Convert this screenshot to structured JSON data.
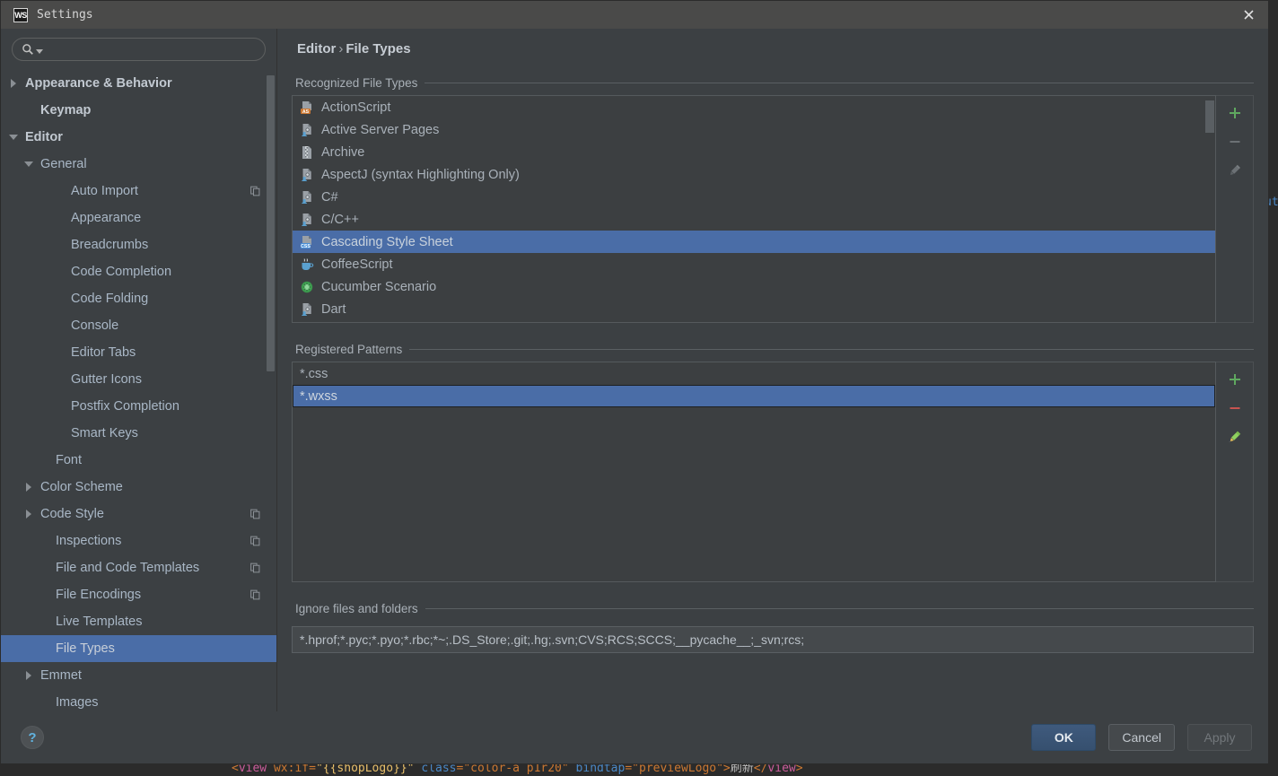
{
  "window": {
    "app_icon_label": "WS",
    "title": "Settings",
    "close_icon": "close-icon"
  },
  "sidebar": {
    "search": {
      "value": "",
      "placeholder": "",
      "icon": "search-icon",
      "dropdown_icon": "chevron-down-icon"
    },
    "items": [
      {
        "label": "Appearance & Behavior",
        "indent": 0,
        "twisty": "closed",
        "bold": true,
        "selected": false,
        "badge": false
      },
      {
        "label": "Keymap",
        "indent": 1,
        "twisty": "none",
        "bold": true,
        "selected": false,
        "badge": false
      },
      {
        "label": "Editor",
        "indent": 0,
        "twisty": "open",
        "bold": true,
        "selected": false,
        "badge": false
      },
      {
        "label": "General",
        "indent": 1,
        "twisty": "open",
        "bold": false,
        "selected": false,
        "badge": false
      },
      {
        "label": "Auto Import",
        "indent": 3,
        "twisty": "none",
        "bold": false,
        "selected": false,
        "badge": true
      },
      {
        "label": "Appearance",
        "indent": 3,
        "twisty": "none",
        "bold": false,
        "selected": false,
        "badge": false
      },
      {
        "label": "Breadcrumbs",
        "indent": 3,
        "twisty": "none",
        "bold": false,
        "selected": false,
        "badge": false
      },
      {
        "label": "Code Completion",
        "indent": 3,
        "twisty": "none",
        "bold": false,
        "selected": false,
        "badge": false
      },
      {
        "label": "Code Folding",
        "indent": 3,
        "twisty": "none",
        "bold": false,
        "selected": false,
        "badge": false
      },
      {
        "label": "Console",
        "indent": 3,
        "twisty": "none",
        "bold": false,
        "selected": false,
        "badge": false
      },
      {
        "label": "Editor Tabs",
        "indent": 3,
        "twisty": "none",
        "bold": false,
        "selected": false,
        "badge": false
      },
      {
        "label": "Gutter Icons",
        "indent": 3,
        "twisty": "none",
        "bold": false,
        "selected": false,
        "badge": false
      },
      {
        "label": "Postfix Completion",
        "indent": 3,
        "twisty": "none",
        "bold": false,
        "selected": false,
        "badge": false
      },
      {
        "label": "Smart Keys",
        "indent": 3,
        "twisty": "none",
        "bold": false,
        "selected": false,
        "badge": false
      },
      {
        "label": "Font",
        "indent": 2,
        "twisty": "none",
        "bold": false,
        "selected": false,
        "badge": false
      },
      {
        "label": "Color Scheme",
        "indent": 1,
        "twisty": "closed",
        "bold": false,
        "selected": false,
        "badge": false
      },
      {
        "label": "Code Style",
        "indent": 1,
        "twisty": "closed",
        "bold": false,
        "selected": false,
        "badge": true
      },
      {
        "label": "Inspections",
        "indent": 2,
        "twisty": "none",
        "bold": false,
        "selected": false,
        "badge": true
      },
      {
        "label": "File and Code Templates",
        "indent": 2,
        "twisty": "none",
        "bold": false,
        "selected": false,
        "badge": true
      },
      {
        "label": "File Encodings",
        "indent": 2,
        "twisty": "none",
        "bold": false,
        "selected": false,
        "badge": true
      },
      {
        "label": "Live Templates",
        "indent": 2,
        "twisty": "none",
        "bold": false,
        "selected": false,
        "badge": false
      },
      {
        "label": "File Types",
        "indent": 2,
        "twisty": "none",
        "bold": false,
        "selected": true,
        "badge": false
      },
      {
        "label": "Emmet",
        "indent": 1,
        "twisty": "closed",
        "bold": false,
        "selected": false,
        "badge": false
      },
      {
        "label": "Images",
        "indent": 2,
        "twisty": "none",
        "bold": false,
        "selected": false,
        "badge": false
      }
    ]
  },
  "main": {
    "breadcrumb": {
      "parent": "Editor",
      "separator": "›",
      "current": "File Types"
    },
    "recognized": {
      "section_label": "Recognized File Types",
      "items": [
        {
          "label": "ActionScript",
          "icon": "actionscript-file-icon",
          "selected": false
        },
        {
          "label": "Active Server Pages",
          "icon": "generic-code-file-icon",
          "selected": false
        },
        {
          "label": "Archive",
          "icon": "archive-file-icon",
          "selected": false
        },
        {
          "label": "AspectJ (syntax Highlighting Only)",
          "icon": "generic-code-file-icon",
          "selected": false
        },
        {
          "label": "C#",
          "icon": "generic-code-file-icon",
          "selected": false
        },
        {
          "label": "C/C++",
          "icon": "generic-code-file-icon",
          "selected": false
        },
        {
          "label": "Cascading Style Sheet",
          "icon": "css-file-icon",
          "selected": true
        },
        {
          "label": "CoffeeScript",
          "icon": "coffeescript-file-icon",
          "selected": false
        },
        {
          "label": "Cucumber Scenario",
          "icon": "cucumber-file-icon",
          "selected": false
        },
        {
          "label": "Dart",
          "icon": "generic-code-file-icon",
          "selected": false
        }
      ],
      "toolbar": [
        {
          "name": "add-file-type-button",
          "icon": "plus-icon",
          "enabled": true
        },
        {
          "name": "remove-file-type-button",
          "icon": "minus-icon",
          "enabled": false
        },
        {
          "name": "edit-file-type-button",
          "icon": "pencil-icon",
          "enabled": false
        }
      ]
    },
    "patterns": {
      "section_label": "Registered Patterns",
      "items": [
        {
          "label": "*.css",
          "selected": false
        },
        {
          "label": "*.wxss",
          "selected": true
        }
      ],
      "toolbar": [
        {
          "name": "add-pattern-button",
          "icon": "plus-icon",
          "enabled": true
        },
        {
          "name": "remove-pattern-button",
          "icon": "minus-icon",
          "enabled": true
        },
        {
          "name": "edit-pattern-button",
          "icon": "pencil-icon",
          "enabled": true
        }
      ]
    },
    "ignore": {
      "section_label": "Ignore files and folders",
      "value": "*.hprof;*.pyc;*.pyo;*.rbc;*~;.DS_Store;.git;.hg;.svn;CVS;RCS;SCCS;__pycache__;_svn;rcs;"
    }
  },
  "footer": {
    "help_icon": "help-icon",
    "help_label": "?",
    "ok_label": "OK",
    "cancel_label": "Cancel",
    "apply_label": "Apply"
  },
  "editor_background": {
    "code_fragment_parts": [
      {
        "text": "<",
        "cls": "tok-punct"
      },
      {
        "text": "view",
        "cls": "tok-pink"
      },
      {
        "text": " wx:if",
        "cls": "tok-orange"
      },
      {
        "text": "=",
        "cls": "tok-punct"
      },
      {
        "text": "\"{{shopLogo}}\"",
        "cls": "tok-brace"
      },
      {
        "text": " class",
        "cls": "tok-blue"
      },
      {
        "text": "=",
        "cls": "tok-punct"
      },
      {
        "text": "\"color-a p1r20\"",
        "cls": "tok-orange"
      },
      {
        "text": " bindtap",
        "cls": "tok-blue"
      },
      {
        "text": "=",
        "cls": "tok-punct"
      },
      {
        "text": "\"previewLogo\"",
        "cls": "tok-orange"
      },
      {
        "text": ">",
        "cls": "tok-punct"
      },
      {
        "text": "刷新",
        "cls": "tok-attr"
      },
      {
        "text": "</",
        "cls": "tok-punct"
      },
      {
        "text": "view",
        "cls": "tok-pink"
      },
      {
        "text": ">",
        "cls": "tok-punct"
      }
    ],
    "right_fragment": "ut"
  },
  "colors": {
    "selection_blue": "#4a6da7",
    "dialog_bg": "#3c4043",
    "list_bg": "#3c3f41",
    "titlebar_bg": "#4a4a49",
    "text": "#a9b7c6",
    "accent_green": "#5fa85f",
    "accent_red": "#c75450",
    "help_blue": "#61b3e0",
    "ide_bg": "#2b2b2b"
  }
}
